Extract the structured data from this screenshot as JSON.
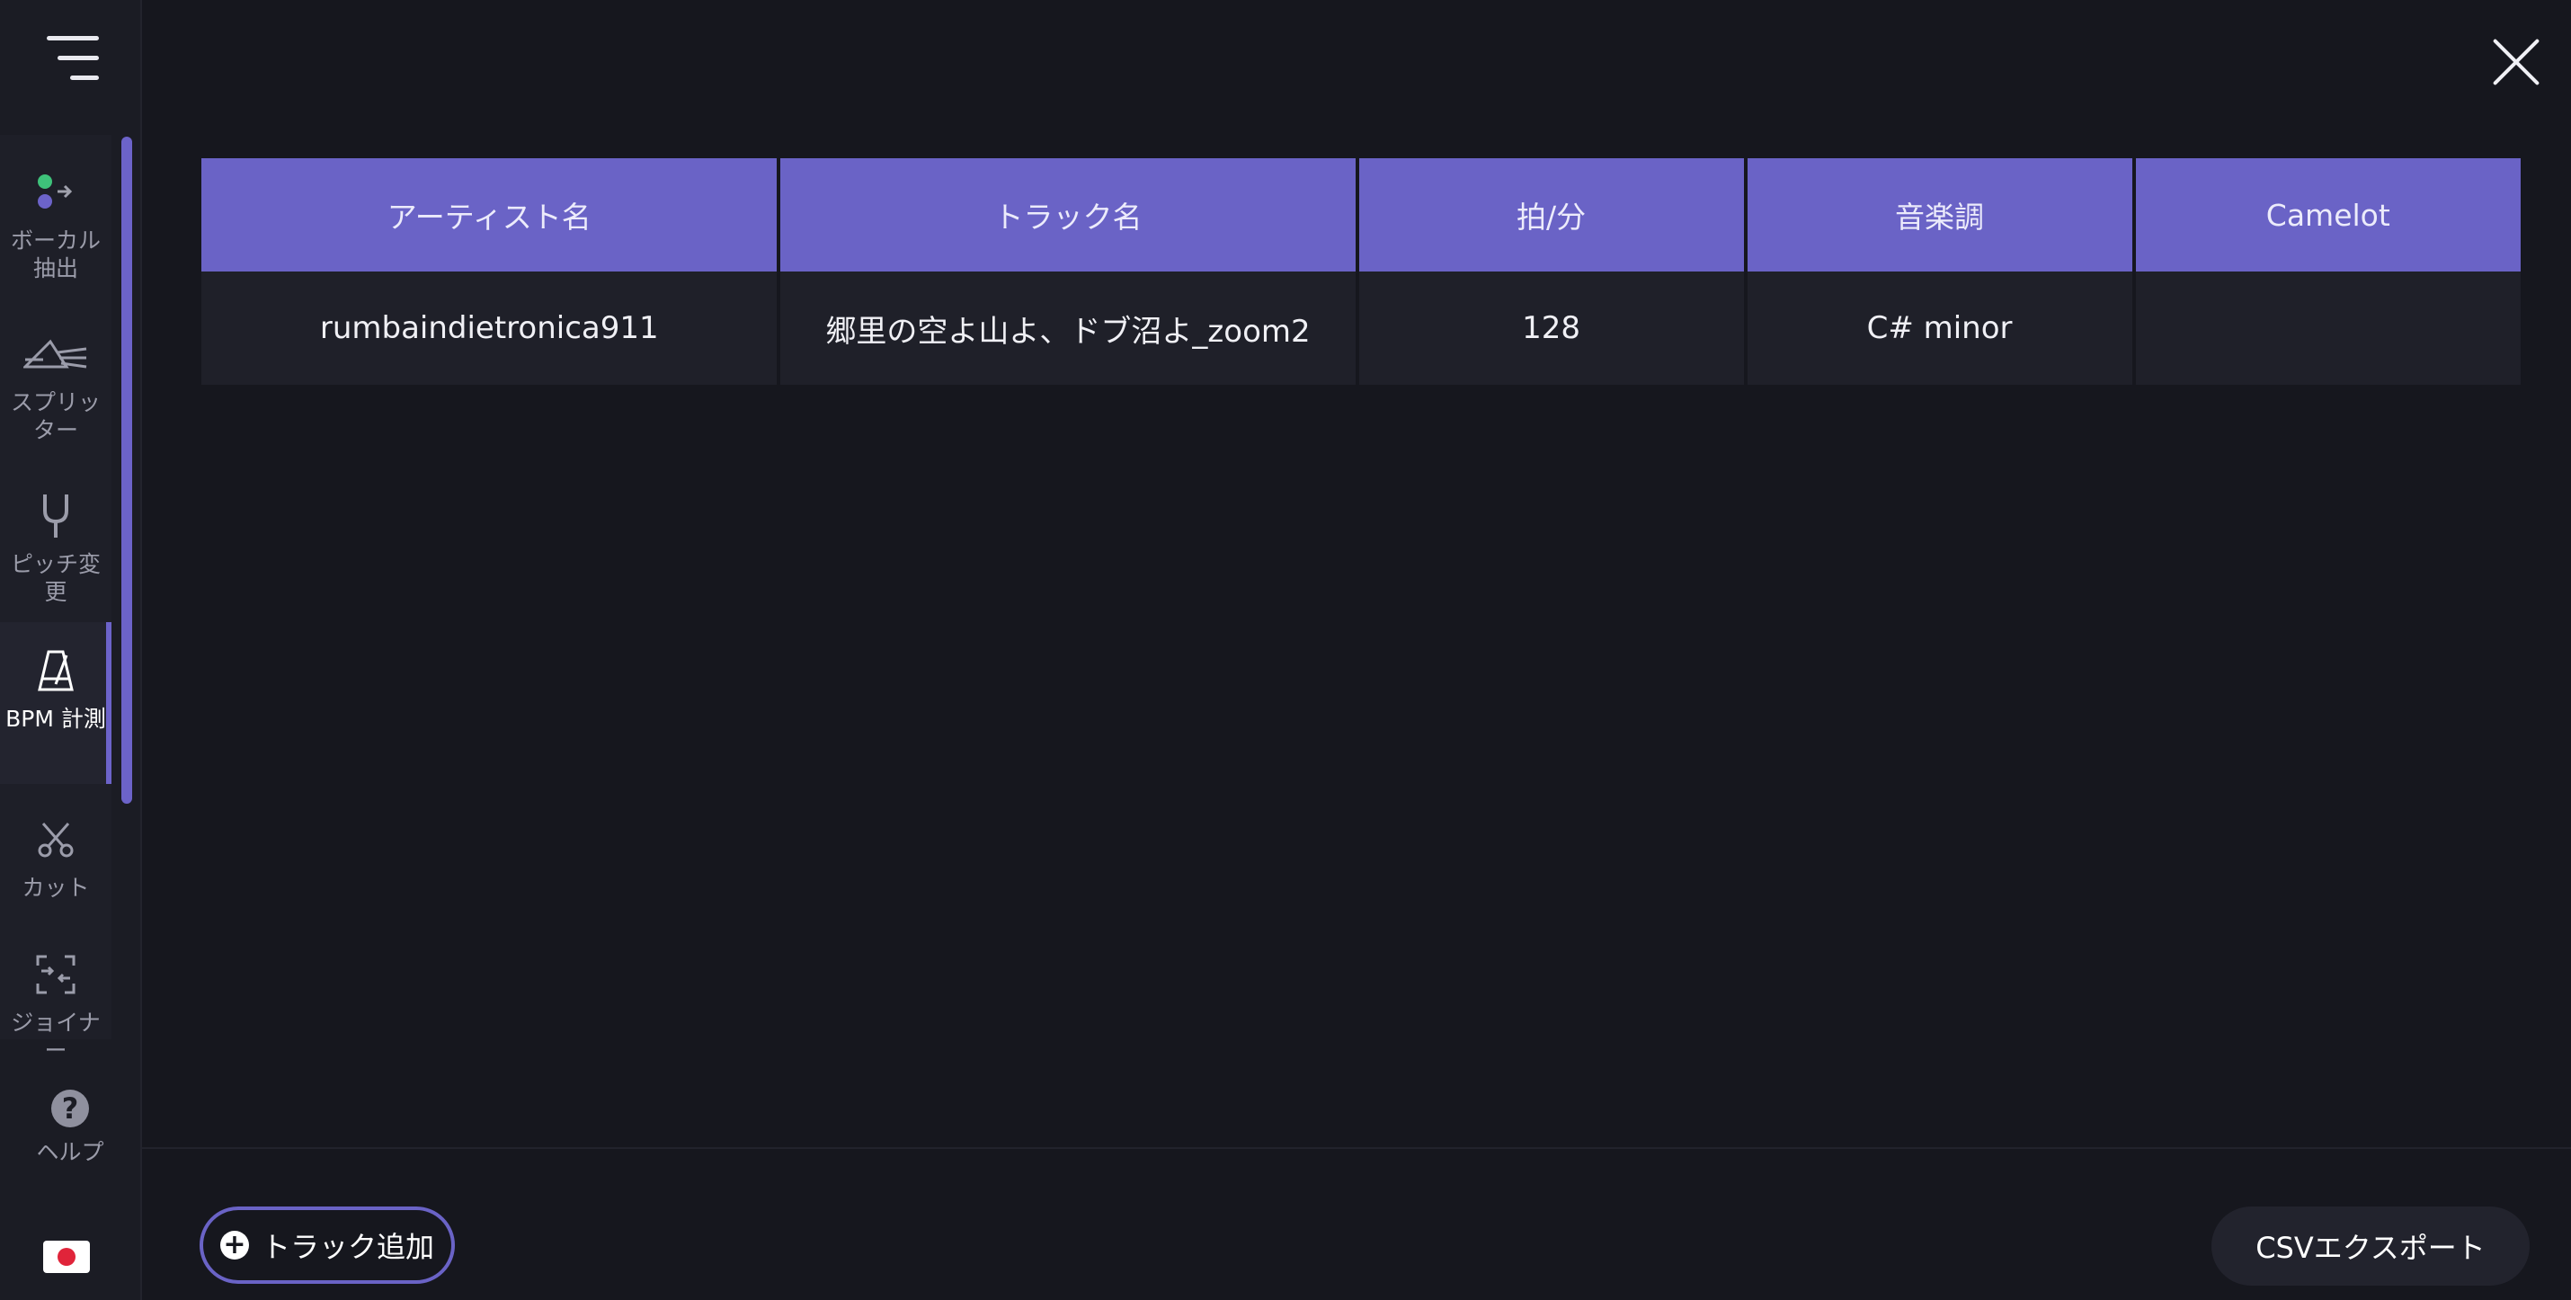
{
  "sidebar": {
    "tools": [
      {
        "label": "ボーカル抽出",
        "icon": "vocal-extract-icon"
      },
      {
        "label": "スプリッター",
        "icon": "splitter-icon"
      },
      {
        "label": "ピッチ変更",
        "icon": "tuning-fork-icon"
      },
      {
        "label": "BPM 計測",
        "icon": "metronome-icon"
      },
      {
        "label": "カット",
        "icon": "scissors-icon"
      },
      {
        "label": "ジョイナー",
        "icon": "joiner-icon"
      }
    ],
    "active_tool": "BPM 計測",
    "help_label": "ヘルプ",
    "language_flag": "jp-flag-icon"
  },
  "table": {
    "headers": [
      "アーティスト名",
      "トラック名",
      "拍/分",
      "音楽調",
      "Camelot"
    ],
    "rows": [
      [
        "rumbaindietronica911",
        "郷里の空よ山よ、ドブ沼よ_zoom2",
        "128",
        "C# minor",
        ""
      ]
    ]
  },
  "footer": {
    "add_track_label": "トラック追加",
    "export_label": "CSVエクスポート"
  },
  "colors": {
    "accent": "#6a63c6",
    "background": "#16171e"
  }
}
